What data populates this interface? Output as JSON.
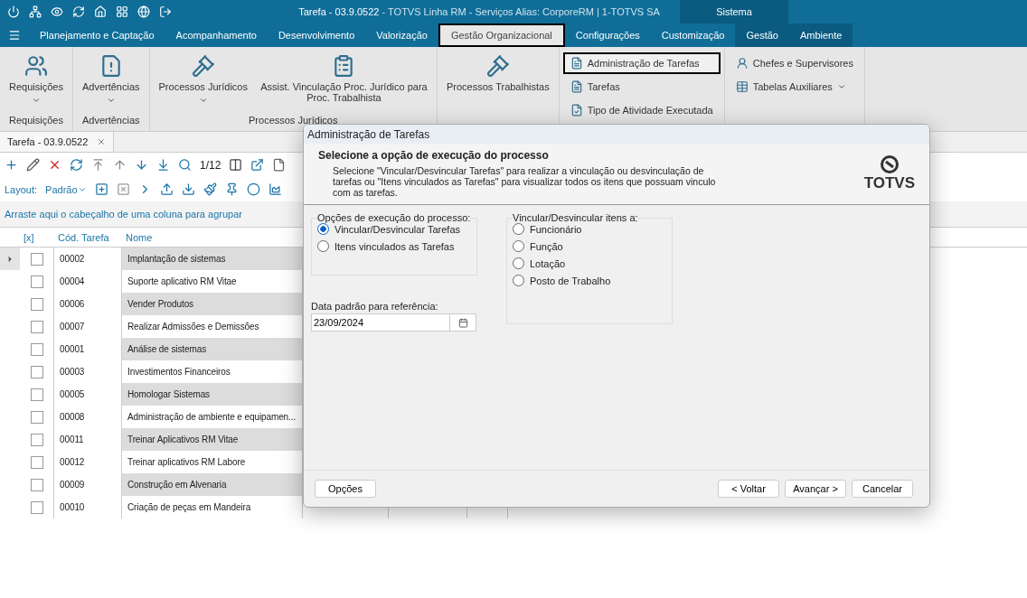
{
  "window": {
    "title": "Tarefa - 03.9.0522",
    "subtitle": "- TOTVS Linha RM - Serviços  Alias: CorporeRM | 1-TOTVS SA",
    "section": "Sistema"
  },
  "menu_tabs": [
    {
      "label": "Planejamento e Captação",
      "selected": false
    },
    {
      "label": "Acompanhamento",
      "selected": false
    },
    {
      "label": "Desenvolvimento",
      "selected": false
    },
    {
      "label": "Valorização",
      "selected": false
    },
    {
      "label": "Gestão Organizacional",
      "selected": true
    },
    {
      "label": "Configurações",
      "selected": false
    },
    {
      "label": "Customização",
      "selected": false
    }
  ],
  "system_tabs": [
    {
      "label": "Gestão",
      "selected": false
    },
    {
      "label": "Ambiente",
      "selected": false
    }
  ],
  "ribbon": [
    {
      "label": "Requisições",
      "items": [
        {
          "kind": "large",
          "label": "Requisições",
          "dropdown": true
        }
      ]
    },
    {
      "label": "Advertências",
      "items": [
        {
          "kind": "large",
          "label": "Advertências",
          "dropdown": true
        }
      ]
    },
    {
      "label": "Processos Jurídicos",
      "items": [
        {
          "kind": "large",
          "label": "Processos Jurídicos",
          "dropdown": true
        },
        {
          "kind": "large",
          "label": "Assist. Vinculação Proc. Jurídico para Proc. Trabalhista",
          "dropdown": false
        }
      ]
    },
    {
      "items": [
        {
          "kind": "large",
          "label": "Processos Trabalhistas",
          "dropdown": false
        }
      ]
    },
    {
      "items": [
        {
          "kind": "small",
          "label": "Administração de Tarefas",
          "highlighted": true
        },
        {
          "kind": "small",
          "label": "Tarefas",
          "highlighted": false
        },
        {
          "kind": "small",
          "label": "Tipo de Atividade Executada",
          "highlighted": false
        }
      ]
    },
    {
      "items": [
        {
          "kind": "small",
          "label": "Chefes e Supervisores",
          "dropdown": false
        },
        {
          "kind": "small",
          "label": "Tabelas Auxiliares",
          "dropdown": true
        }
      ]
    }
  ],
  "doc_tab": {
    "label": "Tarefa - 03.9.0522"
  },
  "toolbar": {
    "counter": "1/12",
    "layout_label": "Layout:",
    "layout_value": "Padrão"
  },
  "group_hint": "Arraste aqui o cabeçalho de uma coluna para agrupar",
  "grid": {
    "columns": [
      "[x]",
      "Cód. Tarefa",
      "Nome"
    ],
    "rows": [
      {
        "code": "00002",
        "name": "Implantação de sistemas",
        "checked": false,
        "current": true
      },
      {
        "code": "00004",
        "name": "Suporte aplicativo RM Vitae",
        "checked": false,
        "current": false
      },
      {
        "code": "00006",
        "name": "Vender Produtos",
        "checked": false,
        "current": false
      },
      {
        "code": "00007",
        "name": "Realizar Admissões e Demissões",
        "checked": false,
        "current": false
      },
      {
        "code": "00001",
        "name": "Análise de sistemas",
        "checked": false,
        "current": false
      },
      {
        "code": "00003",
        "name": "Investimentos Financeiros",
        "checked": false,
        "current": false
      },
      {
        "code": "00005",
        "name": "Homologar Sistemas",
        "checked": false,
        "current": false
      },
      {
        "code": "00008",
        "name": "Administração de ambiente e equipamen...",
        "checked": false,
        "current": false
      },
      {
        "code": "00011",
        "name": "Treinar Aplicativos RM Vitae",
        "checked": false,
        "current": false
      },
      {
        "code": "00012",
        "name": "Treinar aplicativos RM Labore",
        "checked": false,
        "current": false
      },
      {
        "code": "00009",
        "name": "Construção em Alvenaria",
        "checked": false,
        "current": false
      },
      {
        "code": "00010",
        "name": "Criação de peças em Mandeira",
        "checked": false,
        "current": false
      }
    ]
  },
  "dialog": {
    "title": "Administração de Tarefas",
    "heading": "Selecione a opção de execução do processo",
    "description": "Selecione \"Vincular/Desvincular Tarefas\" para realizar a vinculação ou desvinculação de tarefas ou \"Itens vinculados as Tarefas\" para visualizar todos os itens que possuam vinculo com as tarefas.",
    "logo": "TOTVS",
    "options_group": {
      "legend": "Opções de execução do processo:",
      "options": [
        {
          "label": "Vincular/Desvincular Tarefas",
          "selected": true
        },
        {
          "label": "Itens vinculados as Tarefas",
          "selected": false
        }
      ]
    },
    "date_label": "Data padrão para referência:",
    "date_value": "23/09/2024",
    "link_group": {
      "legend": "Vincular/Desvincular itens a:",
      "options": [
        {
          "label": "Funcionário",
          "selected": false
        },
        {
          "label": "Função",
          "selected": false
        },
        {
          "label": "Lotação",
          "selected": false
        },
        {
          "label": "Posto de Trabalho",
          "selected": false
        }
      ]
    },
    "buttons": {
      "options": "Opções",
      "back": "< Voltar",
      "next": "Avançar >",
      "cancel": "Cancelar"
    }
  }
}
